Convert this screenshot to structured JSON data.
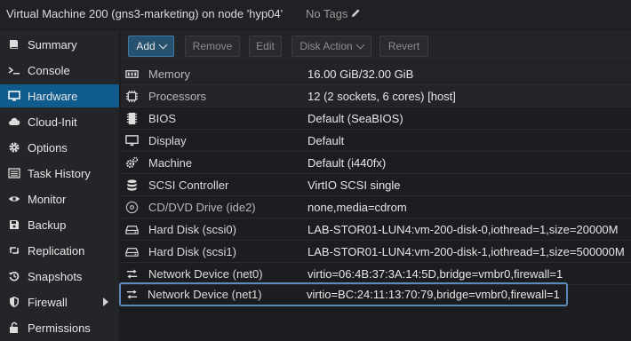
{
  "header": {
    "title": "Virtual Machine 200 (gns3-marketing) on node 'hyp04'",
    "tags": "No Tags"
  },
  "sidebar": {
    "items": [
      {
        "label": "Summary",
        "icon": "book-icon",
        "active": false
      },
      {
        "label": "Console",
        "icon": "terminal-icon",
        "active": false
      },
      {
        "label": "Hardware",
        "icon": "monitor-icon",
        "active": true
      },
      {
        "label": "Cloud-Init",
        "icon": "cloud-icon",
        "active": false
      },
      {
        "label": "Options",
        "icon": "gear-icon",
        "active": false
      },
      {
        "label": "Task History",
        "icon": "list-icon",
        "active": false
      },
      {
        "label": "Monitor",
        "icon": "eye-icon",
        "active": false
      },
      {
        "label": "Backup",
        "icon": "floppy-icon",
        "active": false
      },
      {
        "label": "Replication",
        "icon": "retweet-icon",
        "active": false
      },
      {
        "label": "Snapshots",
        "icon": "history-icon",
        "active": false
      },
      {
        "label": "Firewall",
        "icon": "shield-icon",
        "active": false
      },
      {
        "label": "Permissions",
        "icon": "unlock-icon",
        "active": false
      }
    ]
  },
  "toolbar": {
    "add": "Add",
    "remove": "Remove",
    "edit": "Edit",
    "disk_action": "Disk Action",
    "revert": "Revert"
  },
  "hardware": {
    "rows": [
      {
        "name": "Memory",
        "value": "16.00 GiB/32.00 GiB",
        "icon": "memory-icon"
      },
      {
        "name": "Processors",
        "value": "12 (2 sockets, 6 cores) [host]",
        "icon": "cpu-icon"
      },
      {
        "name": "BIOS",
        "value": "Default (SeaBIOS)",
        "icon": "microchip-icon"
      },
      {
        "name": "Display",
        "value": "Default",
        "icon": "desktop-icon"
      },
      {
        "name": "Machine",
        "value": "Default (i440fx)",
        "icon": "cogs-icon"
      },
      {
        "name": "SCSI Controller",
        "value": "VirtIO SCSI single",
        "icon": "database-icon"
      },
      {
        "name": "CD/DVD Drive (ide2)",
        "value": "none,media=cdrom",
        "icon": "cdrom-icon"
      },
      {
        "name": "Hard Disk (scsi0)",
        "value": "LAB-STOR01-LUN4:vm-200-disk-0,iothread=1,size=20000M",
        "icon": "hdd-icon"
      },
      {
        "name": "Hard Disk (scsi1)",
        "value": "LAB-STOR01-LUN4:vm-200-disk-1,iothread=1,size=500000M",
        "icon": "hdd-icon"
      },
      {
        "name": "Network Device (net0)",
        "value": "virtio=06:4B:37:3A:14:5D,bridge=vmbr0,firewall=1",
        "icon": "exchange-icon"
      },
      {
        "name": "Network Device (net1)",
        "value": "virtio=BC:24:11:13:70:79,bridge=vmbr0,firewall=1",
        "icon": "exchange-icon"
      }
    ]
  },
  "colors": {
    "accent": "#0f5b8e",
    "selection_outline": "#5a8ab8"
  }
}
